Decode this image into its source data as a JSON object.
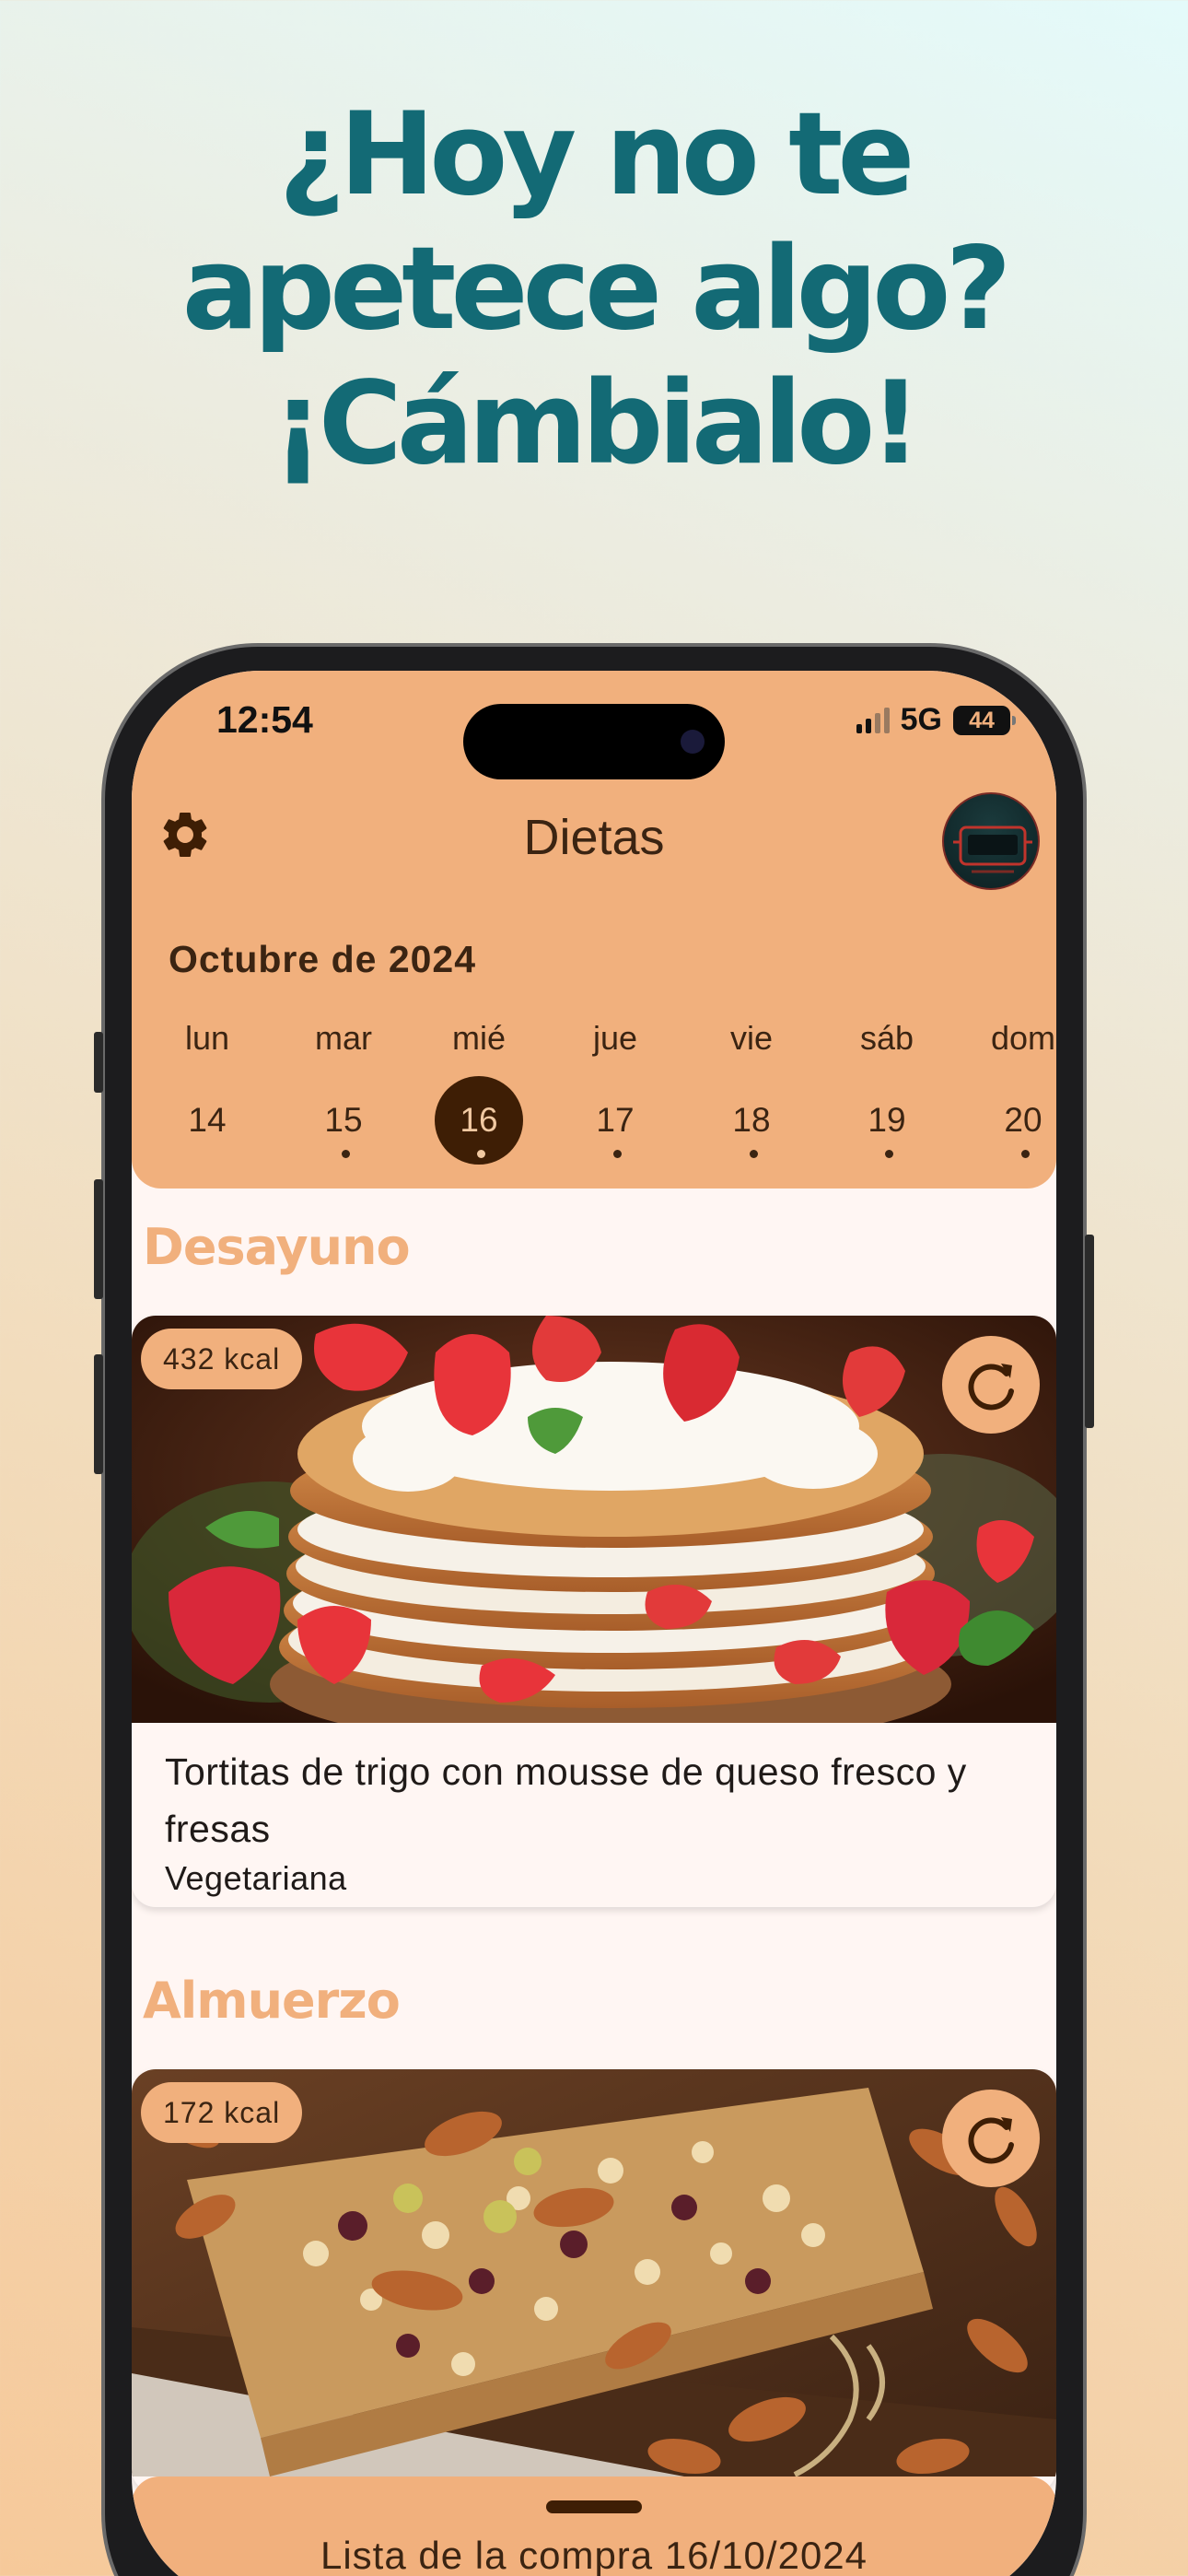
{
  "headline": {
    "line1": "¿Hoy no te",
    "line2": "apetece algo?",
    "line3": "¡Cámbialo!"
  },
  "status_bar": {
    "time": "12:54",
    "network": "5G",
    "battery": "44"
  },
  "app_bar": {
    "title": "Dietas",
    "settings_icon": "gear-icon",
    "avatar_icon": "avatar"
  },
  "calendar": {
    "month": "Octubre de 2024",
    "days": [
      {
        "dow": "lun",
        "num": "14",
        "selected": false,
        "has_dot": false
      },
      {
        "dow": "mar",
        "num": "15",
        "selected": false,
        "has_dot": true
      },
      {
        "dow": "mié",
        "num": "16",
        "selected": true,
        "has_dot": true
      },
      {
        "dow": "jue",
        "num": "17",
        "selected": false,
        "has_dot": true
      },
      {
        "dow": "vie",
        "num": "18",
        "selected": false,
        "has_dot": true
      },
      {
        "dow": "sáb",
        "num": "19",
        "selected": false,
        "has_dot": true
      },
      {
        "dow": "dom",
        "num": "20",
        "selected": false,
        "has_dot": true
      }
    ]
  },
  "meals": [
    {
      "section": "Desayuno",
      "kcal": "432 kcal",
      "name": "Tortitas de trigo con mousse de queso fresco y fresas",
      "tag": "Vegetariana",
      "image": "pancakes-strawberries-photo",
      "refresh_icon": "refresh-icon"
    },
    {
      "section": "Almuerzo",
      "kcal": "172 kcal",
      "image": "granola-bar-photo",
      "refresh_icon": "refresh-icon"
    }
  ],
  "bottom_sheet": {
    "label": "Lista de la compra 16/10/2024"
  },
  "colors": {
    "headline": "#136a75",
    "accent": "#f1b07d",
    "dark_brown": "#3e1e05",
    "card_bg": "#fff6f3"
  }
}
